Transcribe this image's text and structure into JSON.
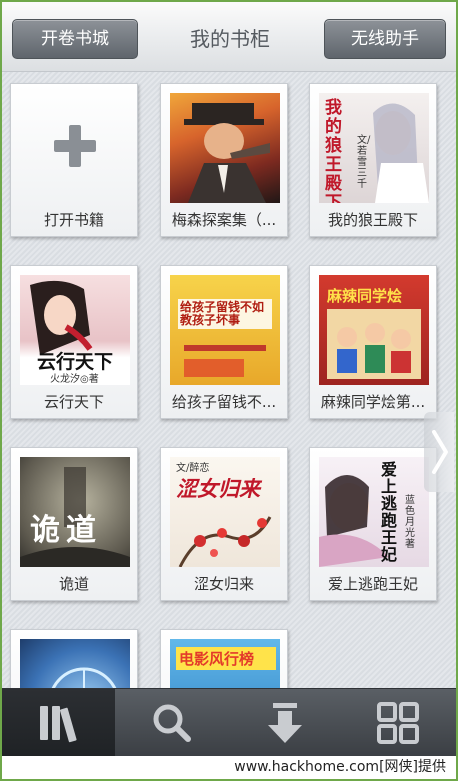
{
  "header": {
    "left_button": "开卷书城",
    "title": "我的书柜",
    "right_button": "无线助手"
  },
  "books": [
    {
      "label": "打开书籍",
      "type": "add",
      "icon": "plus-icon"
    },
    {
      "label": "梅森探案集（...",
      "cover_color": "#b9332a"
    },
    {
      "label": "我的狼王殿下",
      "cover_color": "#e9e4e2",
      "cover_title": "我的狼王殿下",
      "cover_author": "文/若雪三千"
    },
    {
      "label": "云行天下",
      "cover_color": "#c94b57",
      "cover_title": "云行天下",
      "cover_author": "火龙汐◎著"
    },
    {
      "label": "给孩子留钱不...",
      "cover_color": "#f2c23a",
      "cover_title": "给孩子留钱不如教孩子坏事"
    },
    {
      "label": "麻辣同学烩第...",
      "cover_color": "#c62f2f",
      "cover_title": "麻辣同学烩"
    },
    {
      "label": "诡道",
      "cover_color": "#7b7a70",
      "cover_title": "诡道"
    },
    {
      "label": "涩女归来",
      "cover_color": "#f4efe7",
      "cover_title": "涩女归来",
      "cover_author": "文/醉恋"
    },
    {
      "label": "爱上逃跑王妃",
      "cover_color": "#efe8ee",
      "cover_title": "爱上逃跑王妃",
      "cover_author": "蓝色月光 著"
    },
    {
      "label": "",
      "cover_color": "#4b7fbf",
      "partial": true
    },
    {
      "label": "",
      "cover_color": "#3f9cd4",
      "cover_title": "电影风行榜",
      "partial": true
    }
  ],
  "toolbar": {
    "items": [
      {
        "name": "bookshelf",
        "icon": "bookshelf-icon",
        "active": true
      },
      {
        "name": "search",
        "icon": "search-icon"
      },
      {
        "name": "download",
        "icon": "download-icon"
      },
      {
        "name": "grid",
        "icon": "grid-icon"
      }
    ]
  },
  "watermark": "www.hackhome.com[网侠]提供",
  "colors": {
    "frame": "#6fa84a",
    "toolbar": "#45494e",
    "button": "#6b7077"
  }
}
